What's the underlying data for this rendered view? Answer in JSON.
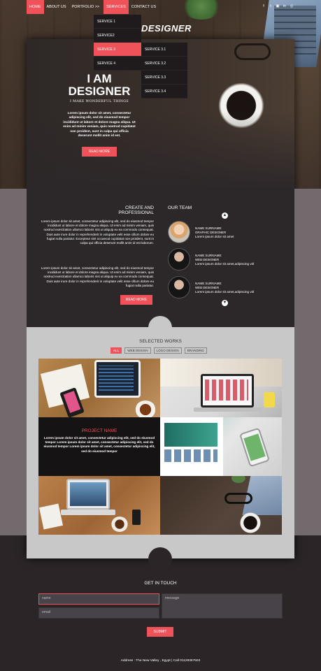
{
  "nav": {
    "items": [
      "HOME",
      "ABOUT US",
      "PORTFOLIO >>",
      "SERVICES",
      "CONTACT US"
    ],
    "social_icons": [
      "facebook-icon",
      "twitter-icon",
      "instagram-icon",
      "linkedin-icon",
      "dribbble-icon"
    ],
    "social_glyphs": [
      "f",
      "t",
      "▣",
      "in",
      "◎"
    ]
  },
  "services_menu": [
    "SERVICE 1",
    "SERVICE2",
    "SERVICE 3",
    "SERVICE 4"
  ],
  "service3_submenu": [
    "SERVICE 3.1",
    "SERVICE 3.2",
    "SERVICE 3.3",
    "SERVICE 3.4"
  ],
  "hero": {
    "script_title": "DESIGNER",
    "title": "I AM DESIGNER",
    "subtitle": "I MAKE WONDERFUL THINGS",
    "text": "Lorem ipsum dolor sit amet, consectetur adipiscing elit, sed do eiusmod tempor incididunt ut labore et dolore magna aliqua. Ut enim ad minim veniam, quis nostrud cupidatat non proident, sunt in culpa qui officia deserunt mollit anim id est.",
    "button": "READ MORE"
  },
  "about": {
    "title": "CREATE AND PROFESSIONAL",
    "para1": "Lorem ipsum dolor sit amet, consectetur adipiscing elit, sed do eiusmod tempor incididunt ut labore et dolore magna aliqua. Ut enim ad minim veniam, quis nostrud exercitation ullamco laboris nisi ut aliquip ex ea commodo consequat. Duis aute irure dolor in reprehenderit in voluptate velit esse cillum dolore eu fugiat nulla pariatur. Excepteur sint occaecat cupidatat non proident, sunt in culpa qui officia deserunt mollit anim id est laborum.",
    "para2": "Lorem ipsum dolor sit amet, consectetur adipiscing elit, sed do eiusmod tempor incididunt ut labore et dolore magna aliqua. Ut enim ad minim veniam, quis nostrud exercitation ullamco laboris nisi ut aliquip ex ea commodo consequat. Duis aute irure dolor in reprehenderit in voluptate velit esse cillum dolore eu fugiat nulla pariatur.",
    "button": "READ MORE"
  },
  "team": {
    "title": "OUR TEAM",
    "members": [
      {
        "name": "NAME SURNAME",
        "role": "GRAPHIC DESIGNER",
        "text": "Lorem ipsum dolor sit amet"
      },
      {
        "name": "NAME SURNAME",
        "role": "WEB DESIGNER",
        "text": "Lorem ipsum dolor sit amet,adipiscing vitl"
      },
      {
        "name": "NAME SURNAME",
        "role": "WEB DESIGNER",
        "text": "Lorem ipsum dolor sit amet,adipiscing vitl"
      }
    ]
  },
  "works": {
    "title": "SELECTED WORKS",
    "filters": [
      "ALL",
      "WEB DESIGN",
      "LOGO DESIGN",
      "BRANDING"
    ],
    "project_name": "PROJECT NAME",
    "project_text": "Lorem ipsum dolor sit amet, consectetur adipiscing elit, sed do eiusmod tempor Lorem ipsum dolor sit amet, consectetur adipiscing elit, sed do eiusmod tempor Lorem ipsum dolor sit amet, consectetur adipiscing elit, sed do eiusmod tempor"
  },
  "contact": {
    "title": "GET IN TOUCH",
    "name_placeholder": "name",
    "email_placeholder": "email",
    "message_placeholder": "message",
    "submit": "SUBMIT"
  },
  "footer": {
    "text": "Address : The New Valley , Egypt  | Call 01128367503"
  },
  "colors": {
    "accent": "#f0525a",
    "dark": "#2c2729",
    "band": "#726a6c",
    "works_bg": "#c8c8c8"
  }
}
